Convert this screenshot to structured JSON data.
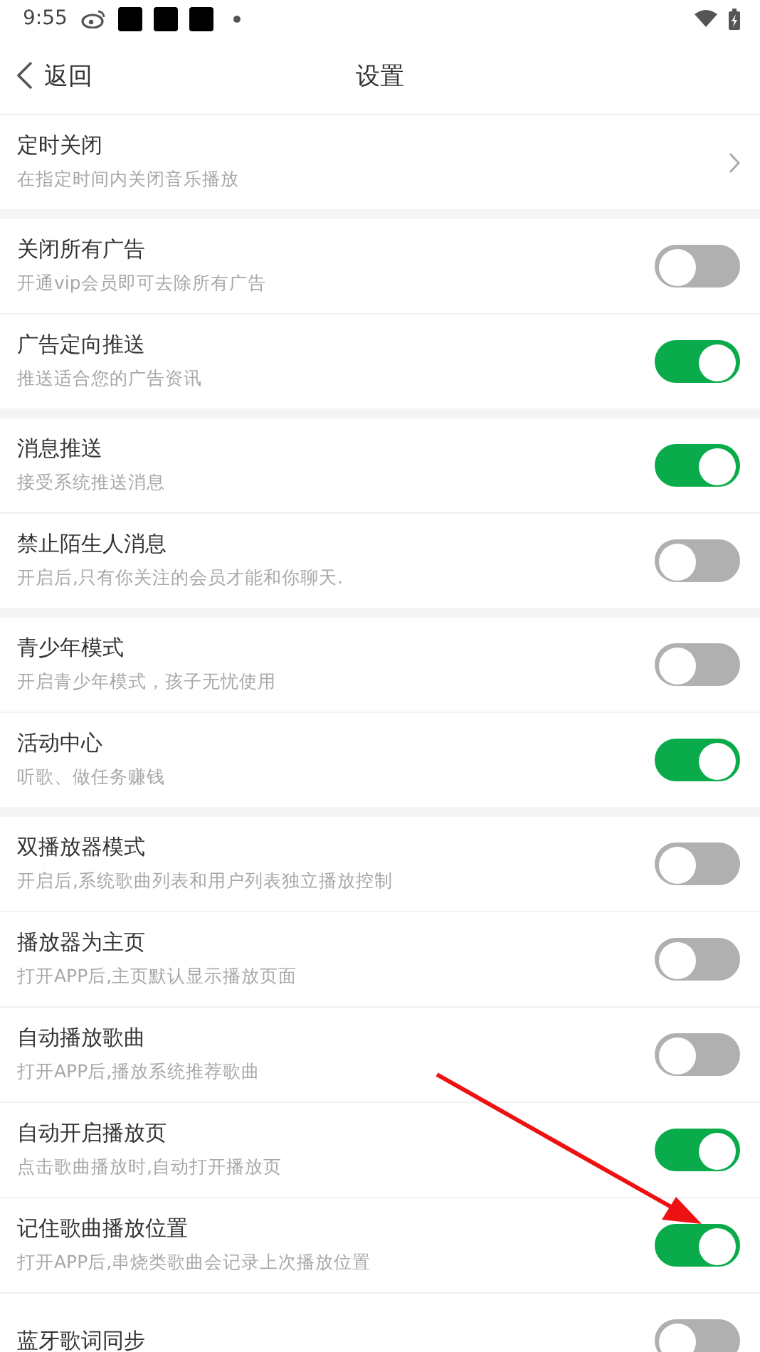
{
  "status_bar": {
    "time": "9:55"
  },
  "header": {
    "back": "返回",
    "title": "设置"
  },
  "groups": [
    {
      "items": [
        {
          "kind": "link",
          "title": "定时关闭",
          "subtitle": "在指定时间内关闭音乐播放"
        }
      ]
    },
    {
      "items": [
        {
          "kind": "toggle",
          "title": "关闭所有广告",
          "subtitle": "开通vip会员即可去除所有广告",
          "on": false
        },
        {
          "kind": "toggle",
          "title": "广告定向推送",
          "subtitle": "推送适合您的广告资讯",
          "on": true
        }
      ]
    },
    {
      "items": [
        {
          "kind": "toggle",
          "title": "消息推送",
          "subtitle": "接受系统推送消息",
          "on": true
        },
        {
          "kind": "toggle",
          "title": "禁止陌生人消息",
          "subtitle": "开启后,只有你关注的会员才能和你聊天.",
          "on": false
        }
      ]
    },
    {
      "items": [
        {
          "kind": "toggle",
          "title": "青少年模式",
          "subtitle": "开启青少年模式，孩子无忧使用",
          "on": false
        },
        {
          "kind": "toggle",
          "title": "活动中心",
          "subtitle": "听歌、做任务赚钱",
          "on": true
        }
      ]
    },
    {
      "items": [
        {
          "kind": "toggle",
          "title": "双播放器模式",
          "subtitle": "开启后,系统歌曲列表和用户列表独立播放控制",
          "on": false
        },
        {
          "kind": "toggle",
          "title": "播放器为主页",
          "subtitle": "打开APP后,主页默认显示播放页面",
          "on": false
        },
        {
          "kind": "toggle",
          "title": "自动播放歌曲",
          "subtitle": "打开APP后,播放系统推荐歌曲",
          "on": false
        },
        {
          "kind": "toggle",
          "title": "自动开启播放页",
          "subtitle": "点击歌曲播放时,自动打开播放页",
          "on": true
        },
        {
          "kind": "toggle",
          "title": "记住歌曲播放位置",
          "subtitle": "打开APP后,串烧类歌曲会记录上次播放位置",
          "on": true
        },
        {
          "kind": "toggle",
          "title": "蓝牙歌词同步",
          "on": false
        }
      ]
    }
  ],
  "annotation_arrow": true
}
